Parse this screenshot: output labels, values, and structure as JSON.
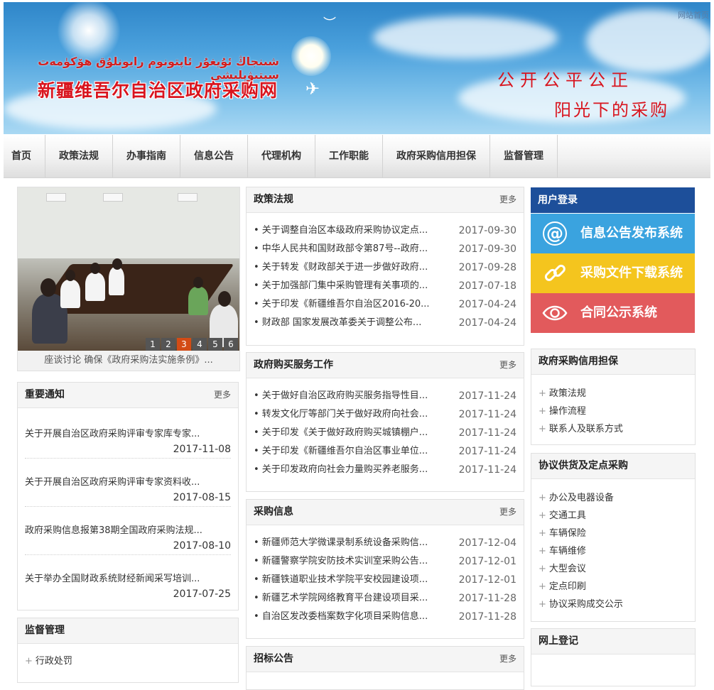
{
  "banner": {
    "uyghur_title": "شىنجاڭ ئۇيغۇر ئاپتونوم رايونلۇق ھۆكۈمەت سېتىۋېلىشى",
    "site_title": "新疆维吾尔自治区政府采购网",
    "slogan_line1": "公开公平公正",
    "slogan_line2": "阳光下的采购",
    "home_link": "网站首页"
  },
  "nav": {
    "items": [
      "首页",
      "政策法规",
      "办事指南",
      "信息公告",
      "代理机构",
      "工作职能",
      "政府采购信用担保",
      "监督管理"
    ]
  },
  "slider": {
    "pages": [
      "1",
      "2",
      "3",
      "4",
      "5",
      "6"
    ],
    "active_page": "3",
    "caption": "座谈讨论 确保《政府采购法实施条例》..."
  },
  "important_notices": {
    "title": "重要通知",
    "more": "更多",
    "items": [
      {
        "title": "关于开展自治区政府采购评审专家库专家...",
        "date": "2017-11-08"
      },
      {
        "title": "关于开展自治区政府采购评审专家资料收...",
        "date": "2017-08-15"
      },
      {
        "title": "政府采购信息报第38期全国政府采购法规...",
        "date": "2017-08-10"
      },
      {
        "title": "关于举办全国财政系统财经新闻采写培训...",
        "date": "2017-07-25"
      }
    ]
  },
  "supervision": {
    "title": "监督管理",
    "items": [
      "行政处罚"
    ]
  },
  "policy": {
    "title": "政策法规",
    "more": "更多",
    "items": [
      {
        "title": "• 关于调整自治区本级政府采购协议定点...",
        "date": "2017-09-30"
      },
      {
        "title": "• 中华人民共和国财政部令第87号--政府...",
        "date": "2017-09-30"
      },
      {
        "title": "• 关于转发《财政部关于进一步做好政府...",
        "date": "2017-09-28"
      },
      {
        "title": "• 关于加强部门集中采购管理有关事项的...",
        "date": "2017-07-18"
      },
      {
        "title": "• 关于印发《新疆维吾尔自治区2016-20...",
        "date": "2017-04-24"
      },
      {
        "title": "• 财政部 国家发展改革委关于调整公布...",
        "date": "2017-04-24"
      }
    ]
  },
  "gov_service": {
    "title": "政府购买服务工作",
    "more": "更多",
    "items": [
      {
        "title": "• 关于做好自治区政府购买服务指导性目...",
        "date": "2017-11-24"
      },
      {
        "title": "• 转发文化厅等部门关于做好政府向社会...",
        "date": "2017-11-24"
      },
      {
        "title": "• 关于印发《关于做好政府购买城镇棚户...",
        "date": "2017-11-24"
      },
      {
        "title": "• 关于印发《新疆维吾尔自治区事业单位...",
        "date": "2017-11-24"
      },
      {
        "title": "• 关于印发政府向社会力量购买养老服务...",
        "date": "2017-11-24"
      }
    ]
  },
  "procurement_info": {
    "title": "采购信息",
    "more": "更多",
    "items": [
      {
        "title": "• 新疆师范大学微课录制系统设备采购信...",
        "date": "2017-12-04"
      },
      {
        "title": "• 新疆警察学院安防技术实训室采购公告...",
        "date": "2017-12-01"
      },
      {
        "title": "• 新疆铁道职业技术学院平安校园建设项...",
        "date": "2017-12-01"
      },
      {
        "title": "• 新疆艺术学院网络教育平台建设项目采...",
        "date": "2017-11-28"
      },
      {
        "title": "• 自治区发改委档案数字化项目采购信息...",
        "date": "2017-11-28"
      }
    ]
  },
  "tender": {
    "title": "招标公告",
    "more": "更多"
  },
  "login": {
    "title": "用户登录",
    "systems": [
      {
        "label": "信息公告发布系统",
        "color": "#3aa3df",
        "icon": "at-icon"
      },
      {
        "label": "采购文件下载系统",
        "color": "#f4c51e",
        "icon": "link-icon"
      },
      {
        "label": "合同公示系统",
        "color": "#e25a5c",
        "icon": "eye-icon"
      }
    ]
  },
  "credit": {
    "title": "政府采购信用担保",
    "items": [
      "政策法规",
      "操作流程",
      "联系人及联系方式"
    ]
  },
  "agreement": {
    "title": "协议供货及定点采购",
    "items": [
      "办公及电器设备",
      "交通工具",
      "车辆保险",
      "车辆维修",
      "大型会议",
      "定点印刷",
      "协议采购成交公示"
    ]
  },
  "online_reg": {
    "title": "网上登记"
  }
}
